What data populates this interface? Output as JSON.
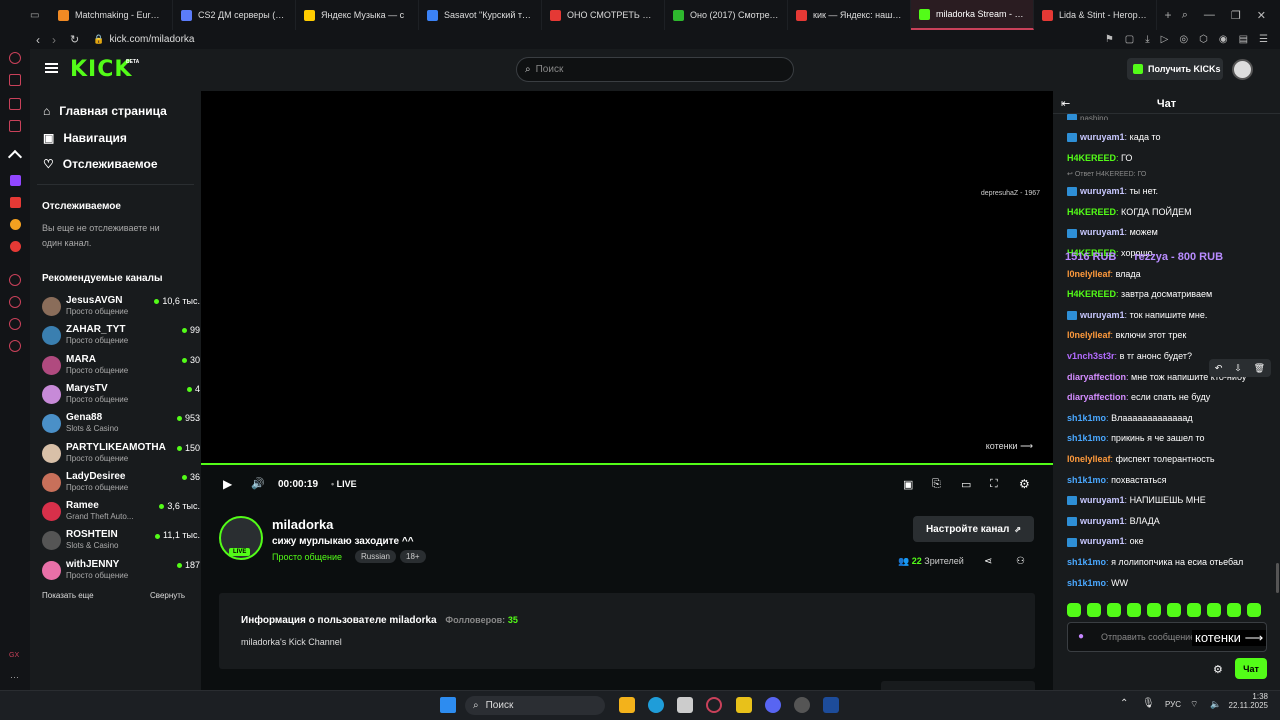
{
  "tabs": [
    {
      "label": "Matchmaking - Europe",
      "color": "#f08a24"
    },
    {
      "label": "CS2 ДМ серверы (CS2)",
      "color": "#5b7cfa"
    },
    {
      "label": "Яндекс Музыка — с",
      "color": "#ffcc00"
    },
    {
      "label": "Sasavot \"Курский танец",
      "color": "#3b82f6"
    },
    {
      "label": "ОНО СМОТРЕТЬ — Ян",
      "color": "#e53935"
    },
    {
      "label": "Оно (2017) Смотреть С",
      "color": "#2eb82e"
    },
    {
      "label": "кик — Яндекс: нашлось",
      "color": "#e53935"
    },
    {
      "label": "miladorka Stream - Watc",
      "color": "#53fc18"
    },
    {
      "label": "Lida & Stint - Негорка -",
      "color": "#e53935"
    }
  ],
  "browser": {
    "url": "kick.com/miladorka",
    "new_tab": "+"
  },
  "header": {
    "logo": "KICK",
    "logo_beta": "BETA",
    "search_placeholder": "Поиск",
    "get_kicks": "Получить KICKs"
  },
  "sidebar": {
    "nav": [
      {
        "label": "Главная страница",
        "icon": "home-icon"
      },
      {
        "label": "Навигация",
        "icon": "compass-icon"
      },
      {
        "label": "Отслеживаемое",
        "icon": "heart-icon"
      }
    ],
    "following_title": "Отслеживаемое",
    "following_empty": "Вы еще не отслеживаете ни один канал.",
    "recommended_title": "Рекомендуемые каналы",
    "channels": [
      {
        "name": "JesusAVGN",
        "category": "Просто общение",
        "viewers": "10,6 тыс.",
        "color": "#8a6d5a"
      },
      {
        "name": "ZAHAR_TYT",
        "category": "Просто общение",
        "viewers": "99",
        "color": "#3a7fb0"
      },
      {
        "name": "MARA",
        "category": "Просто общение",
        "viewers": "30",
        "color": "#b04a7f"
      },
      {
        "name": "MarysTV",
        "category": "Просто общение",
        "viewers": "4",
        "color": "#c78ad8"
      },
      {
        "name": "Gena88",
        "category": "Slots & Casino",
        "viewers": "953",
        "color": "#4a90c8"
      },
      {
        "name": "PARTYLIKEAMOTHA",
        "category": "Просто общение",
        "viewers": "150",
        "color": "#d8c0a8"
      },
      {
        "name": "LadyDesiree",
        "category": "Просто общение",
        "viewers": "36",
        "color": "#c8705a"
      },
      {
        "name": "Ramee",
        "category": "Grand Theft Auto...",
        "viewers": "3,6 тыс.",
        "color": "#d8304a"
      },
      {
        "name": "ROSHTEIN",
        "category": "Slots & Casino",
        "viewers": "11,1 тыс.",
        "color": "#555"
      },
      {
        "name": "withJENNY",
        "category": "Просто общение",
        "viewers": "187",
        "color": "#e870a8"
      }
    ],
    "show_more": "Показать еще",
    "collapse": "Свернуть"
  },
  "video": {
    "overlay_top": "depresuhaZ - 1967",
    "overlay_donations_left": "1516 RUB",
    "overlay_donations_right": "rezzya - 800 RUB",
    "overlay_bottom": "котенки",
    "time": "00:00:19",
    "live": "LIVE",
    "progress": 1.0
  },
  "stream": {
    "channel": "miladorka",
    "title": "сижу мурлыкаю заходите ^^",
    "category": "Просто общение",
    "tags": [
      "Russian",
      "18+"
    ],
    "live_badge": "LIVE",
    "setup_button": "Настройте канал",
    "viewers_count": "22",
    "viewers_label": "Зрителей",
    "about_title": "Информация о пользователе miladorka",
    "followers_label": "Фолловеров:",
    "followers": "35",
    "about_text": "miladorka's Kick Channel"
  },
  "chat": {
    "title": "Чат",
    "messages": [
      {
        "user": "wuruyam1",
        "text": "када то",
        "color": "#c8c8ff",
        "badge": true
      },
      {
        "user": "H4KEREED",
        "text": "ГО",
        "color": "#53fc18",
        "badge": false
      },
      {
        "reply": "Ответ H4KEREED: ГО"
      },
      {
        "user": "wuruyam1",
        "text": "ты нет.",
        "color": "#c8c8ff",
        "badge": true
      },
      {
        "user": "H4KEREED",
        "text": "КОГДА ПОЙДЕМ",
        "color": "#53fc18",
        "badge": false
      },
      {
        "user": "wuruyam1",
        "text": "можем",
        "color": "#c8c8ff",
        "badge": true
      },
      {
        "user": "H4KEREED",
        "text": "хорошо",
        "color": "#53fc18",
        "badge": false
      },
      {
        "user": "l0nelylleaf",
        "text": "влада",
        "color": "#ff9a3c",
        "badge": false
      },
      {
        "user": "H4KEREED",
        "text": "завтра досматриваем",
        "color": "#53fc18",
        "badge": false
      },
      {
        "user": "wuruyam1",
        "text": "ток напишите мне.",
        "color": "#c8c8ff",
        "badge": true
      },
      {
        "user": "l0nelylleaf",
        "text": "включи этот трек",
        "color": "#ff9a3c",
        "badge": false
      },
      {
        "user": "v1nch3st3r",
        "text": "в тг анонс будет?",
        "color": "#b36bff",
        "badge": false
      },
      {
        "user": "diaryaffection",
        "text": "мне тож напишите кто-нибу",
        "color": "#d38cff",
        "badge": false
      },
      {
        "user": "diaryaffection",
        "text": "если спать не буду",
        "color": "#d38cff",
        "badge": false
      },
      {
        "user": "sh1k1mo",
        "text": "Влааааааааааааад",
        "color": "#4aa8ff",
        "badge": false
      },
      {
        "user": "sh1k1mo",
        "text": "прикинь я че зашел то",
        "color": "#4aa8ff",
        "badge": false
      },
      {
        "user": "l0nelylleaf",
        "text": "фиспект толерантность",
        "color": "#ff9a3c",
        "badge": false
      },
      {
        "user": "sh1k1mo",
        "text": "похвастаться",
        "color": "#4aa8ff",
        "badge": false
      },
      {
        "user": "wuruyam1",
        "text": "НАПИШЕШЬ МНЕ",
        "color": "#c8c8ff",
        "badge": true
      },
      {
        "user": "wuruyam1",
        "text": "ВЛАДА",
        "color": "#c8c8ff",
        "badge": true
      },
      {
        "user": "wuruyam1",
        "text": "оке",
        "color": "#c8c8ff",
        "badge": true
      },
      {
        "user": "sh1k1mo",
        "text": "я лолипопчика на есиа отьебал",
        "color": "#4aa8ff",
        "badge": false
      },
      {
        "user": "sh1k1mo",
        "text": "WW",
        "color": "#4aa8ff",
        "badge": false
      }
    ],
    "top_partial": "nashino",
    "input_placeholder": "Отправить сообщение",
    "send_button": "Чат"
  },
  "taskbar": {
    "search": "Поиск",
    "lang": "РУС",
    "time": "1:38",
    "date": "22.11.2025"
  }
}
